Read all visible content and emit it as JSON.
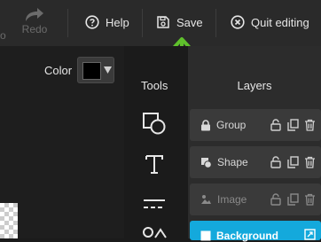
{
  "toolbar": {
    "undo_tail": "o",
    "redo_label": "Redo",
    "help_label": "Help",
    "save_label": "Save",
    "quit_label": "Quit editing"
  },
  "color": {
    "label": "Color",
    "value": "#000000"
  },
  "tools": {
    "title": "Tools",
    "items": [
      "shape-tool-icon",
      "text-tool-icon",
      "line-tool-icon",
      "more-shapes-icon"
    ]
  },
  "layers": {
    "title": "Layers",
    "items": [
      {
        "label": "Group",
        "icon": "lock-icon",
        "state": "normal"
      },
      {
        "label": "Shape",
        "icon": "shape-icon",
        "state": "normal"
      },
      {
        "label": "Image",
        "icon": "image-icon",
        "state": "dim"
      },
      {
        "label": "Background",
        "icon": "square-icon",
        "state": "selected"
      }
    ]
  },
  "colors": {
    "accent_arrow": "#5fc12c",
    "selected_layer": "#14a9dc"
  }
}
